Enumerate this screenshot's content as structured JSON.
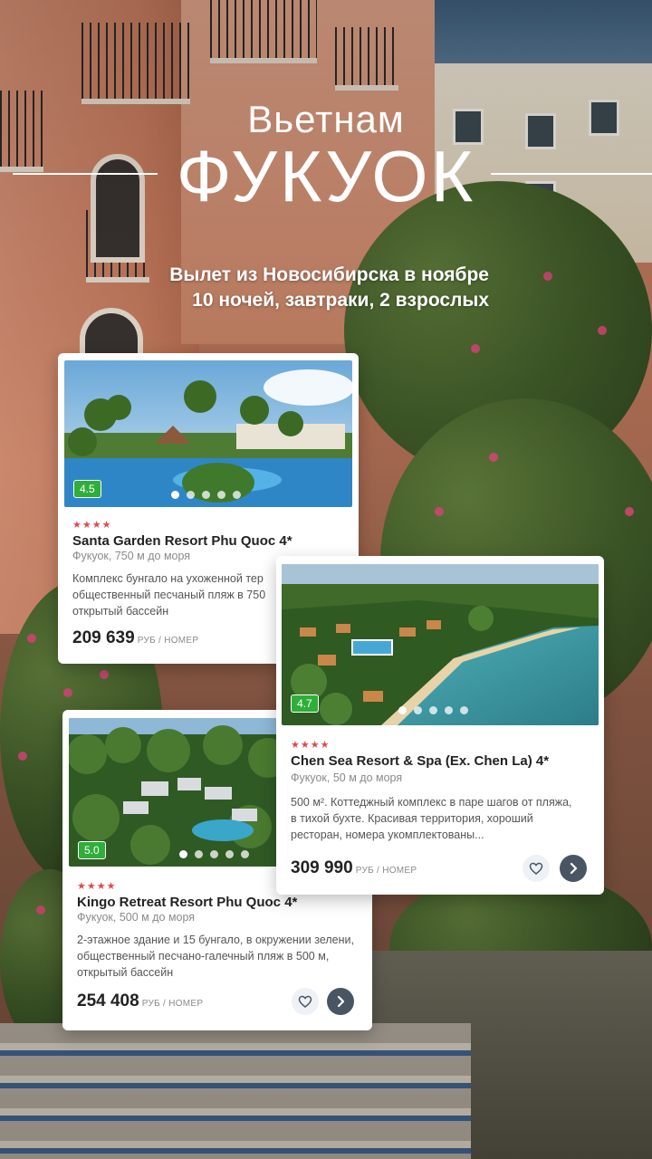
{
  "header": {
    "country": "Вьетнам",
    "city": "ФУКУОК",
    "subtitle_line1": "Вылет из Новосибирска в ноябре",
    "subtitle_line2": "10 ночей, завтраки, 2 взрослых"
  },
  "hotels": [
    {
      "rating": "4.5",
      "stars": "★★★★",
      "name": "Santa Garden Resort Phu Quoc 4*",
      "location": "Фукуок, 750 м до моря",
      "description": "Комплекс бунгало на ухоженной тер общественный песчаный пляж в 750 открытый бассейн",
      "price": "209 639",
      "price_unit": "РУБ / НОМЕР"
    },
    {
      "rating": "4.7",
      "stars": "★★★★",
      "name": "Chen Sea Resort & Spa (Ex. Chen La) 4*",
      "location": "Фукуок, 50 м до моря",
      "description": "500 м². Коттеджный комплекс в паре шагов от пляжа, в тихой бухте. Красивая территория, хороший ресторан, номера укомплектованы...",
      "price": "309 990",
      "price_unit": "РУБ / НОМЕР"
    },
    {
      "rating": "5.0",
      "stars": "★★★★",
      "name": "Kingo Retreat Resort Phu Quoc 4*",
      "location": "Фукуок, 500 м до моря",
      "description": "2-этажное здание и 15 бунгало, в окружении зелени, общественный песчано-галечный пляж в 500 м, открытый бассейн",
      "price": "254 408",
      "price_unit": "РУБ / НОМЕР"
    }
  ],
  "colors": {
    "rating_badge": "#2fae3a",
    "stars": "#e04a4a",
    "next_button": "#4a5563"
  },
  "icons": {
    "favorite": "heart-icon",
    "next": "chevron-right-icon"
  }
}
